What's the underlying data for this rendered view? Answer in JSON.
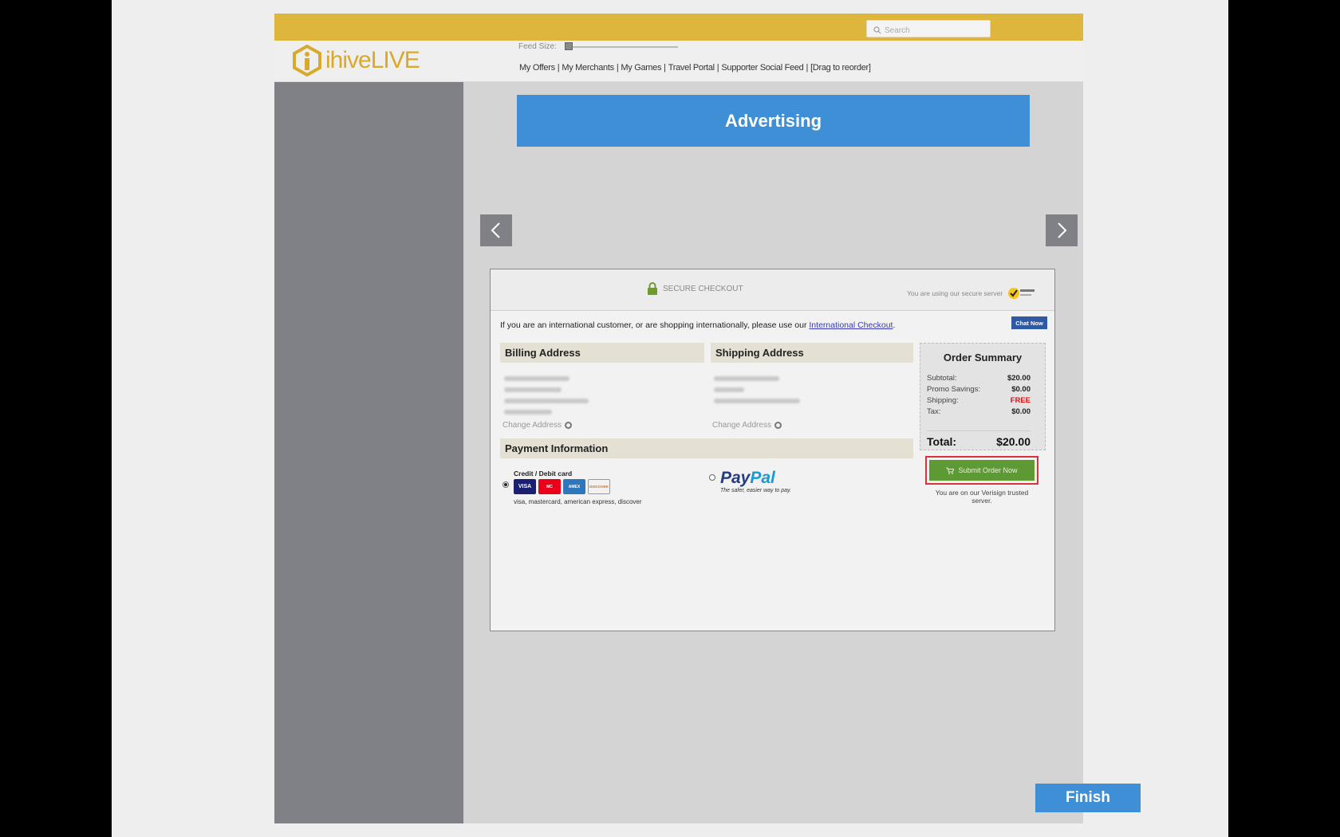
{
  "search": {
    "placeholder": "Search"
  },
  "brand": {
    "logo_part1": "ihive",
    "logo_part2": "LIVE"
  },
  "feed": {
    "label": "Feed Size:",
    "level": 0.02
  },
  "nav": {
    "items": [
      "My Offers",
      "My Merchants",
      "My Games",
      "Travel Portal",
      "Supporter Social Feed",
      "[Drag to reorder]"
    ]
  },
  "ad": {
    "label": "Advertising"
  },
  "checkout": {
    "secure_label": "SECURE CHECKOUT",
    "secure_server": "You are using our secure server",
    "intl_text": "If you are an international customer, or are shopping internationally, please use our",
    "intl_link": "International Checkout",
    "chat_label": "Chat Now",
    "billing": {
      "title": "Billing Address",
      "change": "Change Address"
    },
    "shipping": {
      "title": "Shipping Address",
      "change": "Change Address"
    },
    "payment": {
      "title": "Payment Information",
      "cc_label": "Credit / Debit card",
      "cards": [
        "VISA",
        "MC",
        "AMEX",
        "DISCOVER"
      ],
      "cc_text": "visa, mastercard, american express, discover",
      "paypal_a": "Pay",
      "paypal_b": "Pal",
      "paypal_sub": "The safer, easier way to pay."
    },
    "summary": {
      "title": "Order Summary",
      "rows": [
        {
          "label": "Subtotal:",
          "value": "$20.00"
        },
        {
          "label": "Promo Savings:",
          "value": "$0.00"
        },
        {
          "label": "Shipping:",
          "value": "FREE"
        },
        {
          "label": "Tax:",
          "value": "$0.00"
        }
      ],
      "total_label": "Total:",
      "total_value": "$20.00",
      "submit_label": "Submit Order Now",
      "verisign": "You are on our Verisign trusted server."
    }
  },
  "finish_label": "Finish",
  "colors": {
    "topbar": "#dfb63c",
    "accent_blue": "#3e8fd6",
    "sidebar": "#808186",
    "submit_green": "#5e9a34",
    "highlight_red": "#d8333a"
  }
}
